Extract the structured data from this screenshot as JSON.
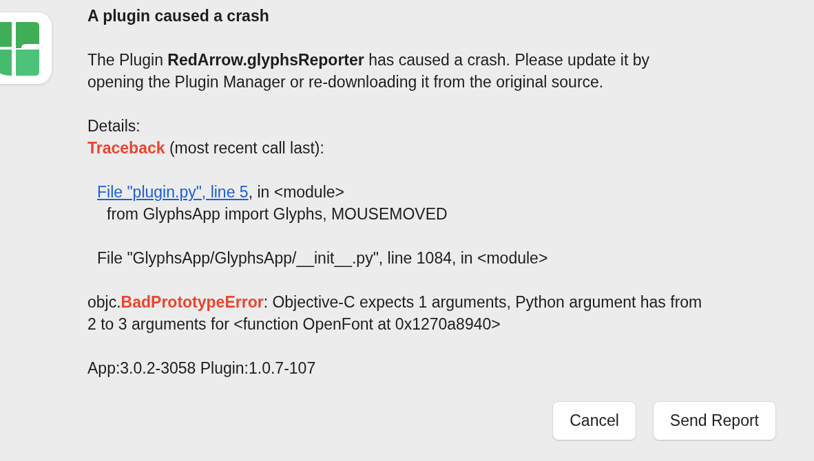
{
  "dialog": {
    "title": "A plugin caused a crash",
    "message": "The Plugin **RedArrow.glyphsReporter** has caused a crash. Please update it by opening the Plugin Manager or re-downloading it from the original source.",
    "details": [
      [
        {
          "kind": "text",
          "segments": [
            {
              "kind": "plain",
              "text": "Details:"
            }
          ]
        },
        {
          "kind": "text",
          "segments": [
            {
              "kind": "error",
              "text": "Traceback"
            },
            {
              "kind": "plain",
              "text": " (most recent call last):"
            }
          ]
        }
      ],
      [
        {
          "kind": "frame",
          "segments": [
            {
              "kind": "link",
              "text": "File \"plugin.py\", line 5"
            },
            {
              "kind": "plain",
              "text": ", in <module>"
            }
          ]
        },
        {
          "kind": "source",
          "segments": [
            {
              "kind": "plain",
              "text": "from GlyphsApp import Glyphs, MOUSEMOVED"
            }
          ]
        }
      ],
      [
        {
          "kind": "frame",
          "segments": [
            {
              "kind": "plain",
              "text": "File \"GlyphsApp/GlyphsApp/__init__.py\", line 1084, in <module>"
            }
          ]
        }
      ],
      [
        {
          "kind": "text",
          "segments": [
            {
              "kind": "plain",
              "text": "objc."
            },
            {
              "kind": "error",
              "text": "BadPrototypeError"
            },
            {
              "kind": "plain",
              "text": ": Objective-C expects 1 arguments, Python argument has from 2 to 3 arguments for <function OpenFont at 0x1270a8940>"
            }
          ]
        }
      ],
      [
        {
          "kind": "text",
          "segments": [
            {
              "kind": "plain",
              "text": "App:3.0.2-3058 Plugin:1.0.7-107"
            }
          ]
        }
      ]
    ],
    "buttons": [
      "Cancel",
      "Send Report"
    ]
  }
}
